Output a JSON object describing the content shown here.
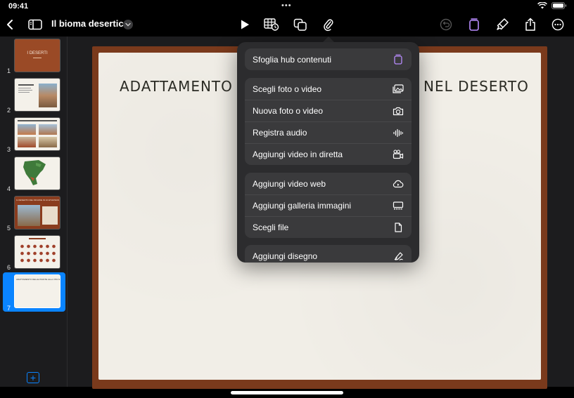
{
  "status": {
    "time": "09:41",
    "dots": "•••"
  },
  "toolbar": {
    "doc_title": "Il bioma desertico",
    "icons": [
      "back-chevron-icon",
      "sidebar-toggle-icon",
      "play-icon",
      "table-icon",
      "shapes-icon",
      "paperclip-icon",
      "undo-icon",
      "content-hub-icon",
      "format-brush-icon",
      "share-icon",
      "more-icon"
    ]
  },
  "sidebar": {
    "slides": [
      {
        "num": "1",
        "title": "I DESERTI"
      },
      {
        "num": "2",
        "title": ""
      },
      {
        "num": "3",
        "title": ""
      },
      {
        "num": "4",
        "title": ""
      },
      {
        "num": "5",
        "title": "IL DESERTO DEL MOJAVE IN 10 ETHUSIAS"
      },
      {
        "num": "6",
        "title": ""
      },
      {
        "num": "7",
        "title": "ADATTAMENTO DELLE PIANTE ALLA VITA NEL DESERTO"
      }
    ]
  },
  "slide": {
    "title_left": "ADATTAMENTO",
    "title_right": "NEL DESERTO"
  },
  "menu": {
    "group1": [
      {
        "label": "Sfoglia hub contenuti",
        "icon": "content-hub-icon"
      }
    ],
    "group2": [
      {
        "label": "Scegli foto o video",
        "icon": "photo-library-icon"
      },
      {
        "label": "Nuova foto o video",
        "icon": "camera-icon"
      },
      {
        "label": "Registra audio",
        "icon": "waveform-icon"
      },
      {
        "label": "Aggiungi video in diretta",
        "icon": "live-video-icon"
      }
    ],
    "group3": [
      {
        "label": "Aggiungi video web",
        "icon": "cloud-icon"
      },
      {
        "label": "Aggiungi galleria immagini",
        "icon": "gallery-icon"
      },
      {
        "label": "Scegli file",
        "icon": "file-icon"
      }
    ],
    "group4": [
      {
        "label": "Aggiungi disegno",
        "icon": "drawing-icon"
      }
    ]
  },
  "colors": {
    "accent": "#0a84ff",
    "hub_purple": "#b98cff",
    "frame": "#7a3a1c",
    "paper": "#f1eee7"
  }
}
